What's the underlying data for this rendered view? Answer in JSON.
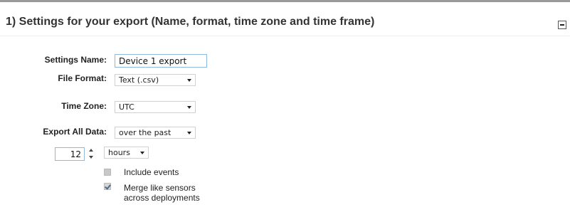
{
  "panel": {
    "title": "1) Settings for your export (Name, format, time zone and time frame)"
  },
  "form": {
    "settings_name": {
      "label": "Settings Name:",
      "value": "Device 1 export"
    },
    "file_format": {
      "label": "File Format:",
      "selected": "Text (.csv)"
    },
    "time_zone": {
      "label": "Time Zone:",
      "selected": "UTC"
    },
    "export_all_data": {
      "label": "Export All Data:",
      "selected": "over the past"
    },
    "duration": {
      "value": "12",
      "unit": "hours"
    },
    "options": [
      {
        "label": "Include events",
        "checked": false
      },
      {
        "label": "Merge like sensors\nacross deployments",
        "label_line1": "Merge like sensors",
        "label_line2": "across deployments",
        "checked": true
      }
    ]
  }
}
